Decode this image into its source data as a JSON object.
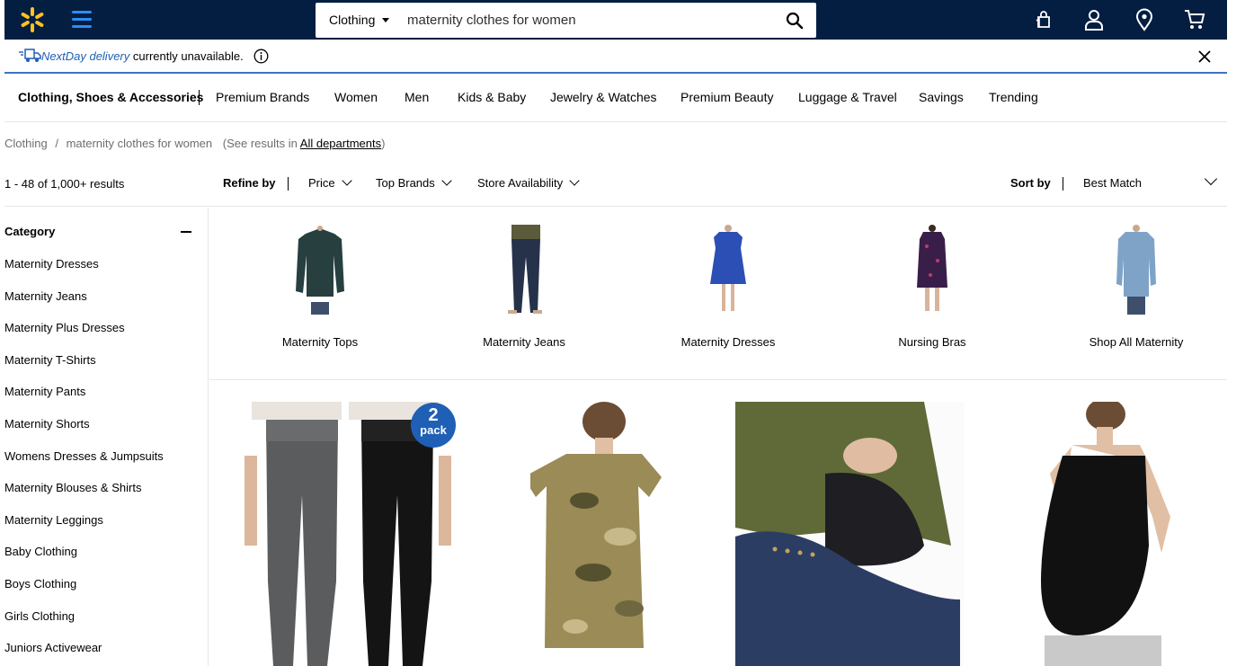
{
  "header": {
    "department": "Clothing",
    "search_value": "maternity clothes for women"
  },
  "notice": {
    "label": "NextDay delivery",
    "text": "currently unavailable."
  },
  "catnav": {
    "items": [
      "Clothing, Shoes & Accessories",
      "Premium Brands",
      "Women",
      "Men",
      "Kids & Baby",
      "Jewelry & Watches",
      "Premium Beauty",
      "Luggage & Travel",
      "Savings",
      "Trending"
    ]
  },
  "breadcrumb": {
    "root": "Clothing",
    "sep": "/",
    "current": "maternity clothes for women",
    "see_prefix": "(See results in",
    "see_link": "All departments",
    "see_suffix": ")"
  },
  "refine": {
    "count": "1 - 48 of 1,000+ results",
    "label": "Refine by",
    "filters": [
      "Price",
      "Top Brands",
      "Store Availability"
    ],
    "sort_label": "Sort by",
    "sort_value": "Best Match"
  },
  "sidebar": {
    "heading": "Category",
    "items": [
      "Maternity Dresses",
      "Maternity Jeans",
      "Maternity Plus Dresses",
      "Maternity T-Shirts",
      "Maternity Pants",
      "Maternity Shorts",
      "Womens Dresses & Jumpsuits",
      "Maternity Blouses & Shirts",
      "Maternity Leggings",
      "Baby Clothing",
      "Boys Clothing",
      "Girls Clothing",
      "Juniors Activewear"
    ]
  },
  "subcategories": [
    "Maternity Tops",
    "Maternity Jeans",
    "Maternity Dresses",
    "Nursing Bras",
    "Shop All Maternity"
  ],
  "products": {
    "badge_number": "2",
    "badge_text": "pack"
  },
  "colors": {
    "header_bg": "#041e42",
    "spark": "#ffc220",
    "accent_blue": "#2f8cf5",
    "notice_border": "#3b73c6"
  }
}
